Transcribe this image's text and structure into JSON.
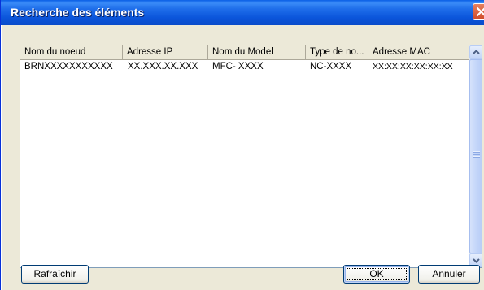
{
  "window": {
    "title": "Recherche des éléments"
  },
  "list": {
    "columns": [
      "Nom du noeud",
      "Adresse IP",
      "Nom du Model",
      "Type de no...",
      "Adresse MAC"
    ],
    "rows": [
      [
        "BRNXXXXXXXXXXX",
        "XX.XXX.XX.XXX",
        "MFC- XXXX",
        "NC-XXXX",
        "XX:XX:XX:XX:XX:XX"
      ]
    ]
  },
  "buttons": {
    "refresh": "Rafraîchir",
    "ok": "OK",
    "cancel": "Annuler"
  },
  "icons": {
    "close": "close-icon",
    "scroll_up": "chevron-up-icon",
    "scroll_down": "chevron-down-icon"
  },
  "colors": {
    "titlebar": "#0A5FE6",
    "dialog_bg": "#ECE9D8",
    "close_button": "#D04B2A",
    "button_border": "#003C74"
  }
}
